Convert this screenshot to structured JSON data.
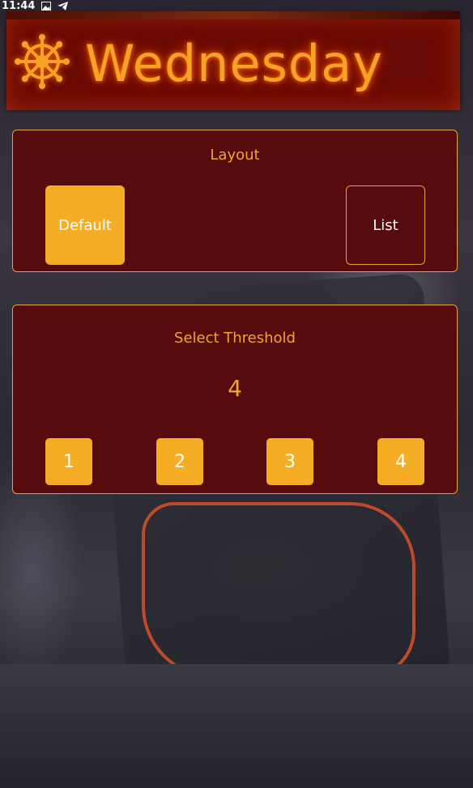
{
  "status_bar": {
    "time": "11:44",
    "icons": [
      "image-icon",
      "telegram-icon"
    ]
  },
  "header": {
    "title": "Wednesday",
    "logo_icon": "ship-wheel-icon"
  },
  "layout_section": {
    "title": "Layout",
    "options": [
      {
        "label": "Default",
        "selected": true
      },
      {
        "label": "List",
        "selected": false
      }
    ]
  },
  "threshold_section": {
    "title": "Select Threshold",
    "current_value": "4",
    "options": [
      "1",
      "2",
      "3",
      "4"
    ]
  },
  "colors": {
    "accent": "#f4ad25",
    "card_bg": "#560c0c",
    "header_bg": "#6a0a04",
    "title_glow": "#ff6a00"
  }
}
